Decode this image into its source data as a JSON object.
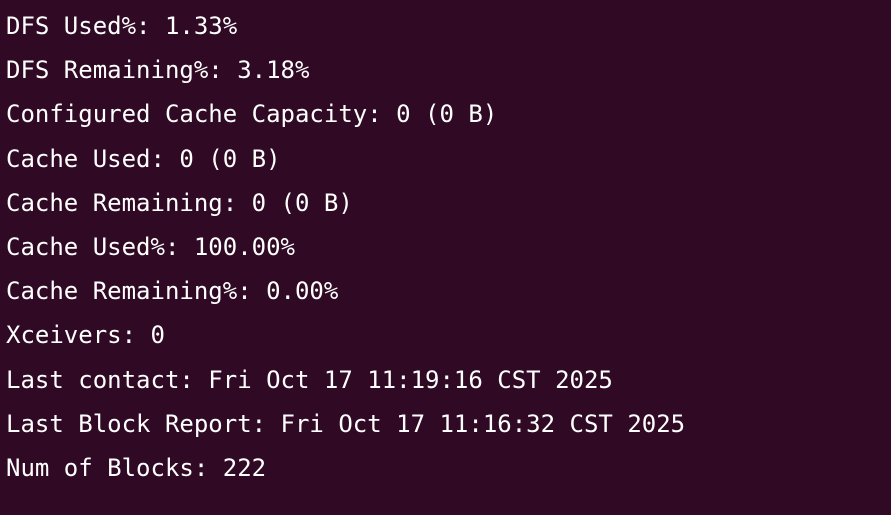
{
  "theme": {
    "background": "#300a24",
    "foreground": "#ffffff"
  },
  "terminal": {
    "lines": [
      "DFS Used%: 1.33%",
      "DFS Remaining%: 3.18%",
      "Configured Cache Capacity: 0 (0 B)",
      "Cache Used: 0 (0 B)",
      "Cache Remaining: 0 (0 B)",
      "Cache Used%: 100.00%",
      "Cache Remaining%: 0.00%",
      "Xceivers: 0",
      "Last contact: Fri Oct 17 11:19:16 CST 2025",
      "Last Block Report: Fri Oct 17 11:16:32 CST 2025",
      "Num of Blocks: 222"
    ]
  }
}
